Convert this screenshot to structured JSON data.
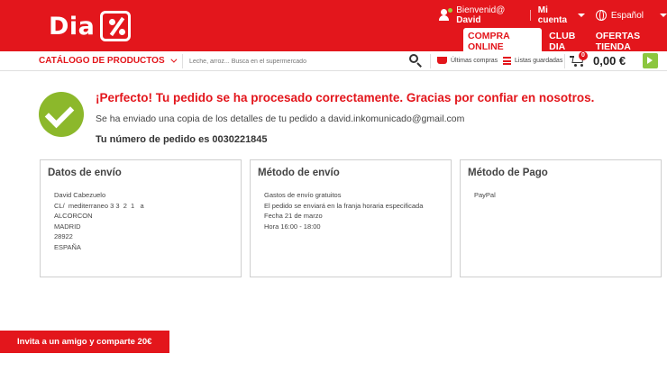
{
  "colors": {
    "brand": "#e3161c",
    "success": "#8cb82b",
    "accent_green": "#8cc63f"
  },
  "header": {
    "logo_text": "Dia",
    "welcome_prefix": "Bienvenid@",
    "user_name": "David",
    "account_label": "Mi cuenta",
    "language": "Español",
    "nav": {
      "compra_online": "COMPRA ONLINE",
      "club_dia": "CLUB DIA",
      "ofertas": "OFERTAS TIENDA"
    }
  },
  "subbar": {
    "catalog_label": "CATÁLOGO DE PRODUCTOS",
    "search_placeholder": "Leche, arroz... Busca en el supermercado",
    "ultimas_compras": "Últimas compras",
    "listas_guardadas": "Listas guardadas",
    "cart_count": "0",
    "cart_total": "0,00 €"
  },
  "confirmation": {
    "title": "¡Perfecto! Tu pedido se ha procesado correctamente. Gracias por confiar en nosotros.",
    "email_note": "Se ha enviado una copia de los detalles de tu pedido a david.inkomunicado@gmail.com",
    "order_number": "Tu número de pedido es 0030221845"
  },
  "cards": {
    "shipping": {
      "title": "Datos de envío",
      "lines": [
        "David Cabezuelo",
        "CL/  mediterraneo 3 3  2  1   a",
        "ALCORCON",
        "MADRID",
        "28922",
        "ESPAÑA"
      ]
    },
    "method": {
      "title": "Método de envío",
      "lines": [
        "Gastos de envío gratuitos",
        "El pedido se enviará en la franja horaria especificada",
        "Fecha 21 de marzo",
        "Hora 16:00 - 18:00"
      ]
    },
    "payment": {
      "title": "Método de Pago",
      "lines": [
        "PayPal"
      ]
    }
  },
  "invite_label": "Invita a un amigo y comparte 20€"
}
